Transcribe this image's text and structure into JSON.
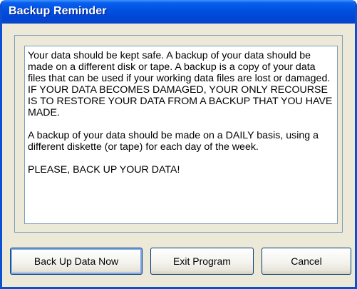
{
  "window": {
    "title": "Backup Reminder"
  },
  "message": {
    "paragraphs": [
      "Your data should be kept safe.  A backup of your data should be made on a different disk or tape.  A backup is a copy of your data files that can be used if your working data files are lost or damaged.  IF YOUR DATA BECOMES DAMAGED, YOUR ONLY RECOURSE IS TO RESTORE YOUR DATA FROM A BACKUP THAT YOU HAVE MADE.",
      "A backup of your data should be made on a DAILY basis, using a different diskette (or tape) for each day of the week.",
      "PLEASE, BACK UP YOUR DATA!"
    ]
  },
  "buttons": {
    "backup_label": "Back Up Data Now",
    "exit_label": "Exit Program",
    "cancel_label": "Cancel"
  },
  "colors": {
    "titlebar": "#0050E0",
    "dialog_background": "#ECE9D8",
    "border": "#7F9DB9"
  }
}
